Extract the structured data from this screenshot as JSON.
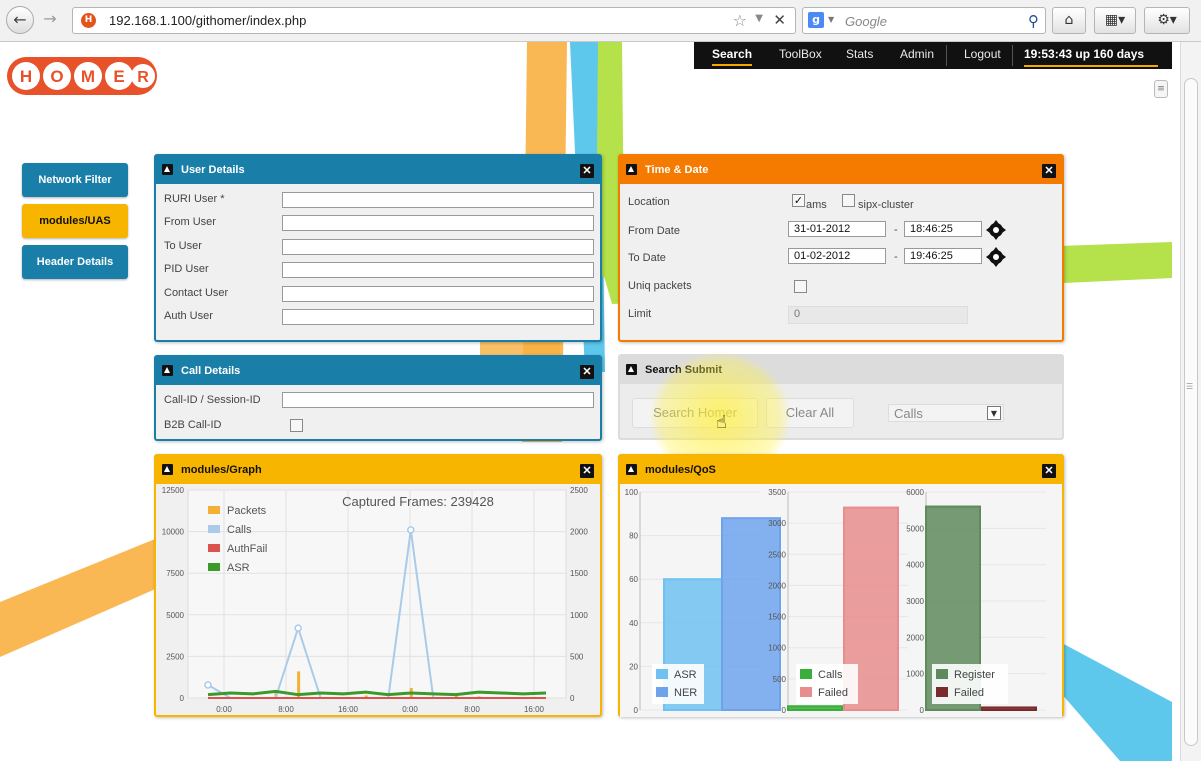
{
  "browser": {
    "url": "192.168.1.100/githomer/index.php",
    "favicon_letter": "H",
    "search_placeholder": "Google",
    "google_letter": "g"
  },
  "topnav": {
    "items": [
      "Search",
      "ToolBox",
      "Stats",
      "Admin",
      "Logout"
    ],
    "clock": "19:53:43 up 160 days"
  },
  "logo": {
    "text": "HOMER"
  },
  "sidebar": {
    "items": [
      {
        "label": "Network Filter"
      },
      {
        "label": "modules/UAS"
      },
      {
        "label": "Header Details"
      }
    ]
  },
  "user_details": {
    "title": "User Details",
    "fields": [
      {
        "label": "RURI User *",
        "value": ""
      },
      {
        "label": "From User",
        "value": ""
      },
      {
        "label": "To User",
        "value": ""
      },
      {
        "label": "PID User",
        "value": ""
      },
      {
        "label": "Contact User",
        "value": ""
      },
      {
        "label": "Auth User",
        "value": ""
      }
    ]
  },
  "call_details": {
    "title": "Call Details",
    "callid_label": "Call-ID / Session-ID",
    "callid_value": "",
    "b2b_label": "B2B Call-ID"
  },
  "time_date": {
    "title": "Time & Date",
    "location_label": "Location",
    "loc_opt1": "ams",
    "loc_opt2": "sipx-cluster",
    "from_label": "From Date",
    "from_date": "31-01-2012",
    "from_time": "18:46:25",
    "to_label": "To Date",
    "to_date": "01-02-2012",
    "to_time": "19:46:25",
    "dash": "-",
    "uniq_label": "Uniq packets",
    "limit_label": "Limit",
    "limit_value": "0"
  },
  "search_submit": {
    "title": "Search Submit",
    "search_button": "Search Homer",
    "clear_button": "Clear All",
    "select_value": "Calls"
  },
  "graph": {
    "title": "modules/Graph",
    "caption": "Captured Frames: 239428"
  },
  "qos": {
    "title": "modules/QoS"
  },
  "colors": {
    "blue": "#1a7fa8",
    "orange": "#f47a00",
    "yellow": "#f7b500",
    "topnav_bg": "#111111"
  },
  "chart_data": [
    {
      "type": "line",
      "left_ylim": [
        0,
        12500
      ],
      "left_yticks": [
        "12500",
        "10000",
        "7500",
        "5000",
        "2500",
        "0"
      ],
      "right_ylim": [
        0,
        2500
      ],
      "right_yticks": [
        "2500",
        "2000",
        "1500",
        "1000",
        "500",
        "0"
      ],
      "x_ticks": [
        "0:00",
        "8:00",
        "16:00",
        "0:00",
        "8:00",
        "16:00"
      ],
      "legend": "top-left",
      "grid": true,
      "series": [
        {
          "name": "Packets",
          "color": "#f2b134",
          "values": [
            0,
            0,
            0,
            300,
            1600,
            0,
            0,
            150,
            0,
            600,
            0,
            200,
            100,
            0,
            0,
            0
          ]
        },
        {
          "name": "Calls",
          "color": "#a9cbe9",
          "values": [
            780,
            0,
            0,
            0,
            4200,
            0,
            0,
            0,
            0,
            10100,
            0,
            0,
            0,
            0,
            0,
            0
          ]
        },
        {
          "name": "AuthFail",
          "color": "#d9534f",
          "values": [
            0,
            0,
            0,
            0,
            0,
            0,
            0,
            0,
            0,
            0,
            0,
            0,
            0,
            0,
            0,
            0
          ]
        },
        {
          "name": "ASR",
          "color": "#3a9a2a",
          "values": [
            200,
            300,
            250,
            400,
            200,
            300,
            250,
            350,
            200,
            300,
            250,
            200,
            350,
            300,
            250,
            300
          ]
        }
      ],
      "x": [
        "t1",
        "t2",
        "t3",
        "t4",
        "t5",
        "t6",
        "t7",
        "t8",
        "t9",
        "t10",
        "t11",
        "t12",
        "t13",
        "t14",
        "t15",
        "t16"
      ]
    },
    {
      "type": "bar",
      "ylim": [
        0,
        100
      ],
      "yticks": [
        "100",
        "80",
        "60",
        "40",
        "20",
        "0"
      ],
      "series": [
        {
          "name": "ASR",
          "color": "#6fc1f1",
          "values": [
            60
          ]
        },
        {
          "name": "NER",
          "color": "#6ea3ec",
          "values": [
            88
          ]
        }
      ]
    },
    {
      "type": "bar",
      "ylim": [
        0,
        3500
      ],
      "yticks": [
        "3500",
        "3000",
        "2500",
        "2000",
        "1500",
        "1000",
        "500",
        "0"
      ],
      "series": [
        {
          "name": "Calls",
          "color": "#3aad3a",
          "values": [
            60
          ]
        },
        {
          "name": "Failed",
          "color": "#e88d8d",
          "values": [
            3250
          ]
        }
      ]
    },
    {
      "type": "bar",
      "ylim": [
        0,
        6000
      ],
      "yticks": [
        "6000",
        "5000",
        "4000",
        "3000",
        "2000",
        "1000",
        "0"
      ],
      "series": [
        {
          "name": "Register",
          "color": "#5f8a5c",
          "values": [
            5600
          ]
        },
        {
          "name": "Failed",
          "color": "#7a2b2b",
          "values": [
            70
          ]
        }
      ]
    }
  ]
}
